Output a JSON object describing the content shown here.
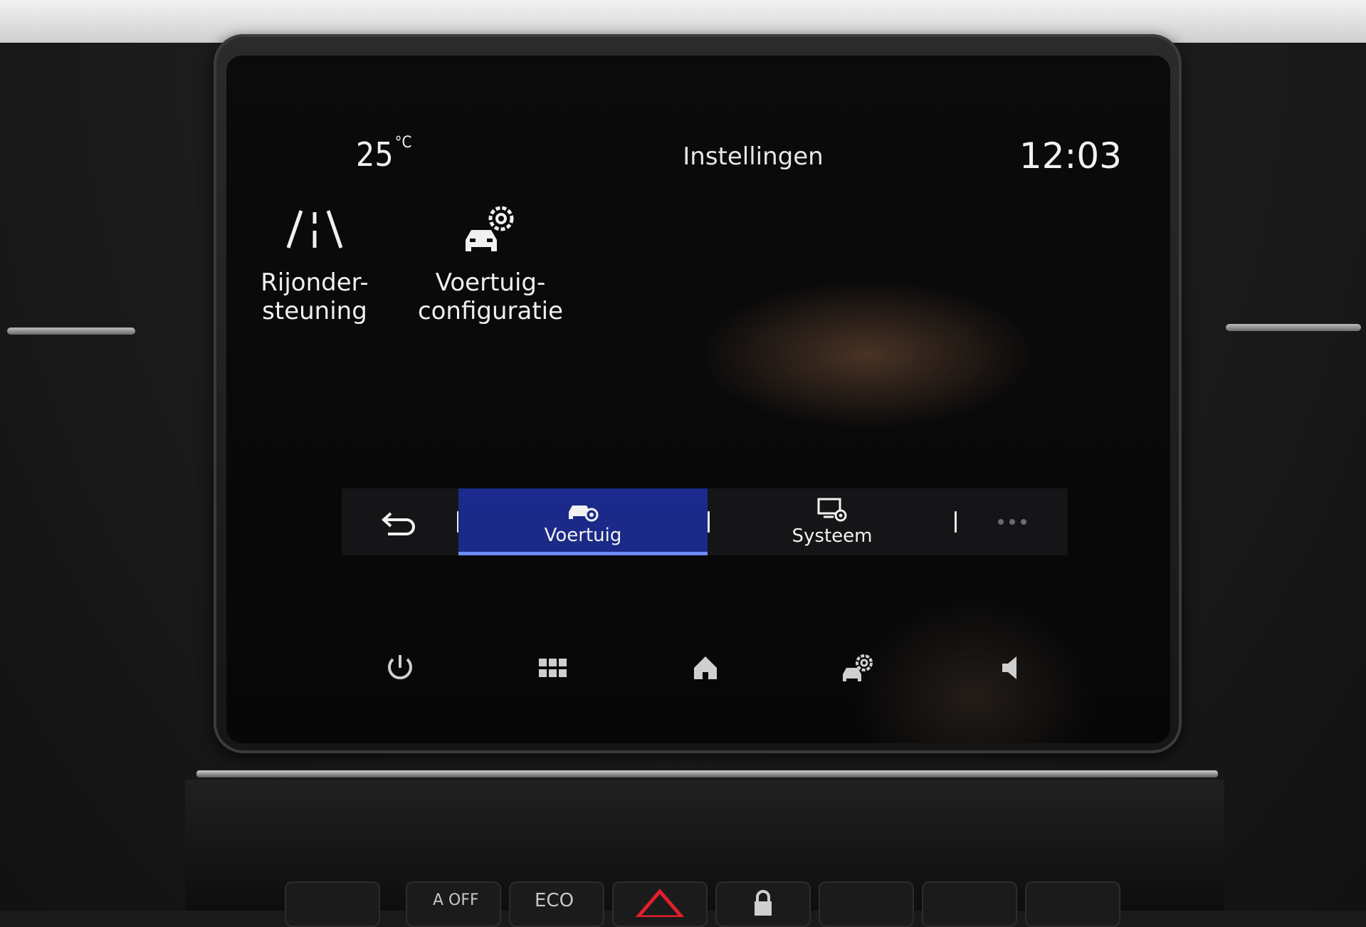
{
  "status_bar": {
    "temperature": "25",
    "temperature_unit": "°C",
    "title": "Instellingen",
    "clock": "12:03"
  },
  "tiles": [
    {
      "label_line1": "Rijonder-",
      "label_line2": "steuning",
      "icon": "lane-assist-icon"
    },
    {
      "label_line1": "Voertuig-",
      "label_line2": "configuratie",
      "icon": "car-settings-icon"
    }
  ],
  "tabs": [
    {
      "label": "",
      "icon": "back-arrow-icon"
    },
    {
      "label": "Voertuig",
      "icon": "car-gear-icon",
      "active": true
    },
    {
      "label": "Systeem",
      "icon": "system-settings-icon",
      "active": false
    },
    {
      "label": "",
      "icon": "more-dots-icon"
    }
  ],
  "bottom_bar": [
    {
      "icon": "power-icon"
    },
    {
      "icon": "apps-grid-icon"
    },
    {
      "icon": "home-icon"
    },
    {
      "icon": "car-settings-icon"
    },
    {
      "icon": "volume-icon"
    }
  ],
  "console_buttons": {
    "eco": "ECO",
    "auto_off": "A OFF"
  },
  "colors": {
    "active_tab": "#1b2a8c",
    "active_underline": "#6f8cff",
    "text": "#f0f0f0"
  }
}
